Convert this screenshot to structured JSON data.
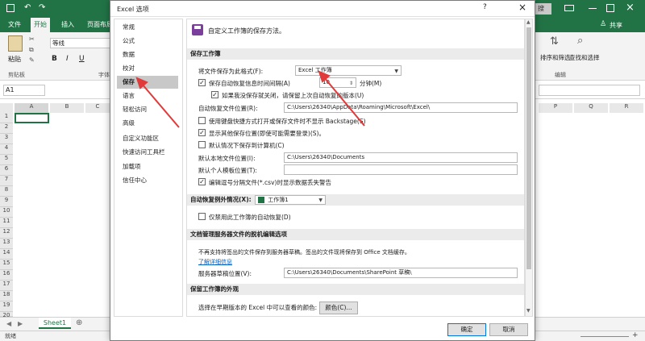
{
  "excel": {
    "tabs": [
      "文件",
      "开始",
      "插入",
      "页面布局"
    ],
    "right_tabs": {
      "share": "共享"
    },
    "font_name": "等线",
    "paste": "粘贴",
    "clipboard": "剪贴板",
    "font_group": "字体",
    "name_box": "A1",
    "columns_left": [
      "A",
      "B",
      "C"
    ],
    "columns_right": [
      "P",
      "Q",
      "R"
    ],
    "rows": [
      "1",
      "2",
      "3",
      "4",
      "5",
      "6",
      "7",
      "8",
      "9",
      "10",
      "11",
      "12",
      "13",
      "14",
      "15",
      "16",
      "17",
      "18",
      "19",
      "20"
    ],
    "sort_filter": "排序和筛选",
    "find_select": "查找和选择",
    "editing_group": "编辑",
    "sheet_tab": "Sheet1",
    "status_text": "就绪",
    "zoom_label": "+",
    "search_badge": "搜",
    "bold": "B",
    "italic": "I",
    "underline": "U"
  },
  "dialog": {
    "title": "Excel 选项",
    "help": "?",
    "close": "×",
    "nav": [
      {
        "label": "常规"
      },
      {
        "label": "公式"
      },
      {
        "label": "数据"
      },
      {
        "label": "校对"
      },
      {
        "label": "保存",
        "active": true
      },
      {
        "label": "语言"
      },
      {
        "label": "轻松访问"
      },
      {
        "label": "高级"
      },
      {
        "label": "自定义功能区"
      },
      {
        "label": "快速访问工具栏"
      },
      {
        "label": "加载项"
      },
      {
        "label": "信任中心"
      }
    ],
    "header": "自定义工作簿的保存方法。",
    "sec_save": "保存工作簿",
    "format_label": "将文件保存为此格式(F):",
    "format_value": "Excel 工作簿",
    "autorecover_label": "保存自动恢复信息时间间隔(A)",
    "autorecover_minutes": "10",
    "minutes_label": "分钟(M)",
    "keep_last_label": "如果我没保存就关闭，请保留上次自动恢复的版本(U)",
    "autorecover_loc_label": "自动恢复文件位置(R):",
    "autorecover_loc_value": "C:\\Users\\26340\\AppData\\Roaming\\Microsoft\\Excel\\",
    "backstage_label": "使用键盘快捷方式打开或保存文件时不显示 Backstage(S)",
    "show_more_label": "显示其他保存位置(即使可能需要登录)(S)。",
    "save_computer_label": "默认情况下保存到计算机(C)",
    "default_loc_label": "默认本地文件位置(I):",
    "default_loc_value": "C:\\Users\\26340\\Documents",
    "personal_template_label": "默认个人模板位置(T):",
    "personal_template_value": "",
    "csv_warn_label": "编辑逗号分隔文件(*.csv)时显示数据丢失警告",
    "sec_exceptions": "自动恢复例外情况(X):",
    "workbook_value": "工作簿1",
    "disable_autorecover_label": "仅禁用此工作簿的自动恢复(D)",
    "sec_offline": "文档管理服务器文件的脱机编辑选项",
    "offline_desc": "不再支持将签出的文件保存到服务器草稿。签出的文件现将保存到 Office 文档缓存。",
    "learn_more": "了解详细信息",
    "drafts_label": "服务器草稿位置(V):",
    "drafts_value": "C:\\Users\\26340\\Documents\\SharePoint 草稿\\",
    "sec_appearance": "保留工作簿的外观",
    "colors_desc": "选择在早期版本的 Excel 中可以查看的颜色:",
    "colors_btn": "颜色(C)...",
    "ok": "确定",
    "cancel": "取消"
  },
  "colors": {
    "excel_green": "#217346",
    "arrow_red": "#e03a3a",
    "nav_active_bg": "#c8c8c8",
    "section_bg": "#ebebeb"
  }
}
